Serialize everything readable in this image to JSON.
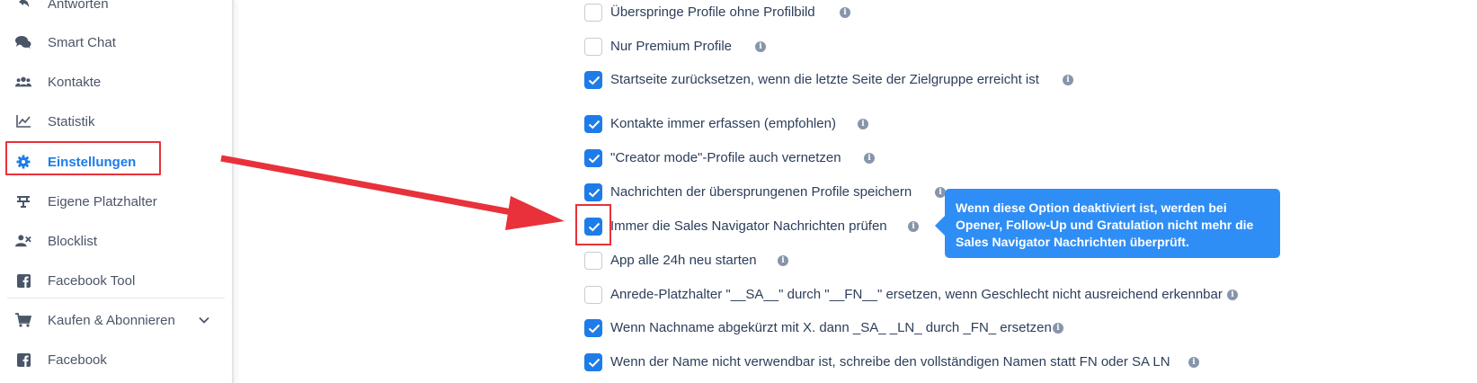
{
  "sidebar": {
    "items": [
      {
        "label": "Antworten",
        "icon": "reply-icon"
      },
      {
        "label": "Smart Chat",
        "icon": "chat-bubbles-icon"
      },
      {
        "label": "Kontakte",
        "icon": "users-icon"
      },
      {
        "label": "Statistik",
        "icon": "chart-line-icon"
      },
      {
        "label": "Einstellungen",
        "icon": "gear-icon",
        "active": true
      },
      {
        "label": "Eigene Platzhalter",
        "icon": "placeholder-icon"
      },
      {
        "label": "Blocklist",
        "icon": "user-block-icon"
      },
      {
        "label": "Facebook Tool",
        "icon": "facebook-icon"
      },
      {
        "label": "Kaufen & Abonnieren",
        "icon": "cart-icon"
      },
      {
        "label": "Facebook",
        "icon": "facebook-icon"
      }
    ]
  },
  "options": [
    {
      "label": "Überspringe Profile ohne Profilbild",
      "checked": false
    },
    {
      "label": "Nur Premium Profile",
      "checked": false
    },
    {
      "label": "Startseite zurücksetzen, wenn die letzte Seite der Zielgruppe erreicht ist",
      "checked": true
    },
    {
      "label": "Kontakte immer erfassen (empfohlen)",
      "checked": true
    },
    {
      "label": "\"Creator mode\"-Profile auch vernetzen",
      "checked": true
    },
    {
      "label": "Nachrichten der übersprungenen Profile speichern",
      "checked": true
    },
    {
      "label": "Immer die Sales Navigator Nachrichten prüfen",
      "checked": true
    },
    {
      "label": "App alle 24h neu starten",
      "checked": false
    },
    {
      "label": "Anrede-Platzhalter \"__SA__\" durch \"__FN__\" ersetzen, wenn Geschlecht nicht ausreichend erkennbar",
      "checked": false
    },
    {
      "label": "Wenn Nachname abgekürzt mit X. dann _SA_ _LN_ durch _FN_ ersetzen",
      "checked": true
    },
    {
      "label": "Wenn der Name nicht verwendbar ist, schreibe den vollständigen Namen statt FN oder SA LN",
      "checked": true
    }
  ],
  "info_glyph": "i",
  "tooltip": {
    "text": "Wenn diese Option deaktiviert ist, werden bei Opener, Follow-Up und Gratulation nicht mehr die Sales Navigator Nachrichten überprüft."
  },
  "colors": {
    "accent": "#1d7ce8",
    "highlight": "#e8313a",
    "tooltip": "#2f8ef5"
  }
}
